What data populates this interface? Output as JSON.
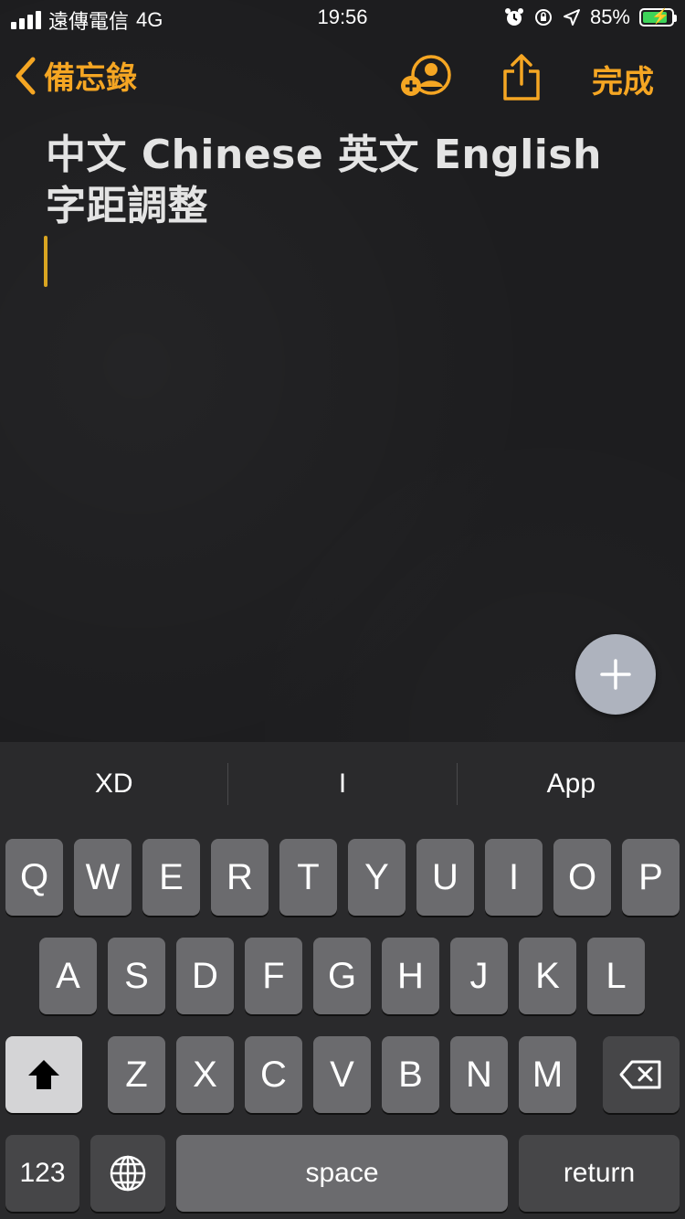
{
  "status_bar": {
    "carrier": "遠傳電信",
    "network": "4G",
    "time": "19:56",
    "battery": "85%",
    "icons": [
      "signal-icon",
      "alarm-icon",
      "orientation-lock-icon",
      "location-icon",
      "battery-charging-icon"
    ]
  },
  "nav": {
    "back_label": "備忘錄",
    "done_label": "完成",
    "accent_color": "#f5a623",
    "icons": [
      "chevron-left-icon",
      "add-collaborator-icon",
      "share-icon"
    ]
  },
  "note": {
    "title": "中文 Chinese 英文 English 字距調整"
  },
  "keyboard": {
    "predictions": [
      "XD",
      "I",
      "App"
    ],
    "row1": [
      "Q",
      "W",
      "E",
      "R",
      "T",
      "Y",
      "U",
      "I",
      "O",
      "P"
    ],
    "row2": [
      "A",
      "S",
      "D",
      "F",
      "G",
      "H",
      "J",
      "K",
      "L"
    ],
    "row3": [
      "Z",
      "X",
      "C",
      "V",
      "B",
      "N",
      "M"
    ],
    "numbers_label": "123",
    "space_label": "space",
    "return_label": "return",
    "icons": [
      "shift-icon",
      "delete-icon",
      "globe-icon",
      "plus-icon"
    ]
  }
}
